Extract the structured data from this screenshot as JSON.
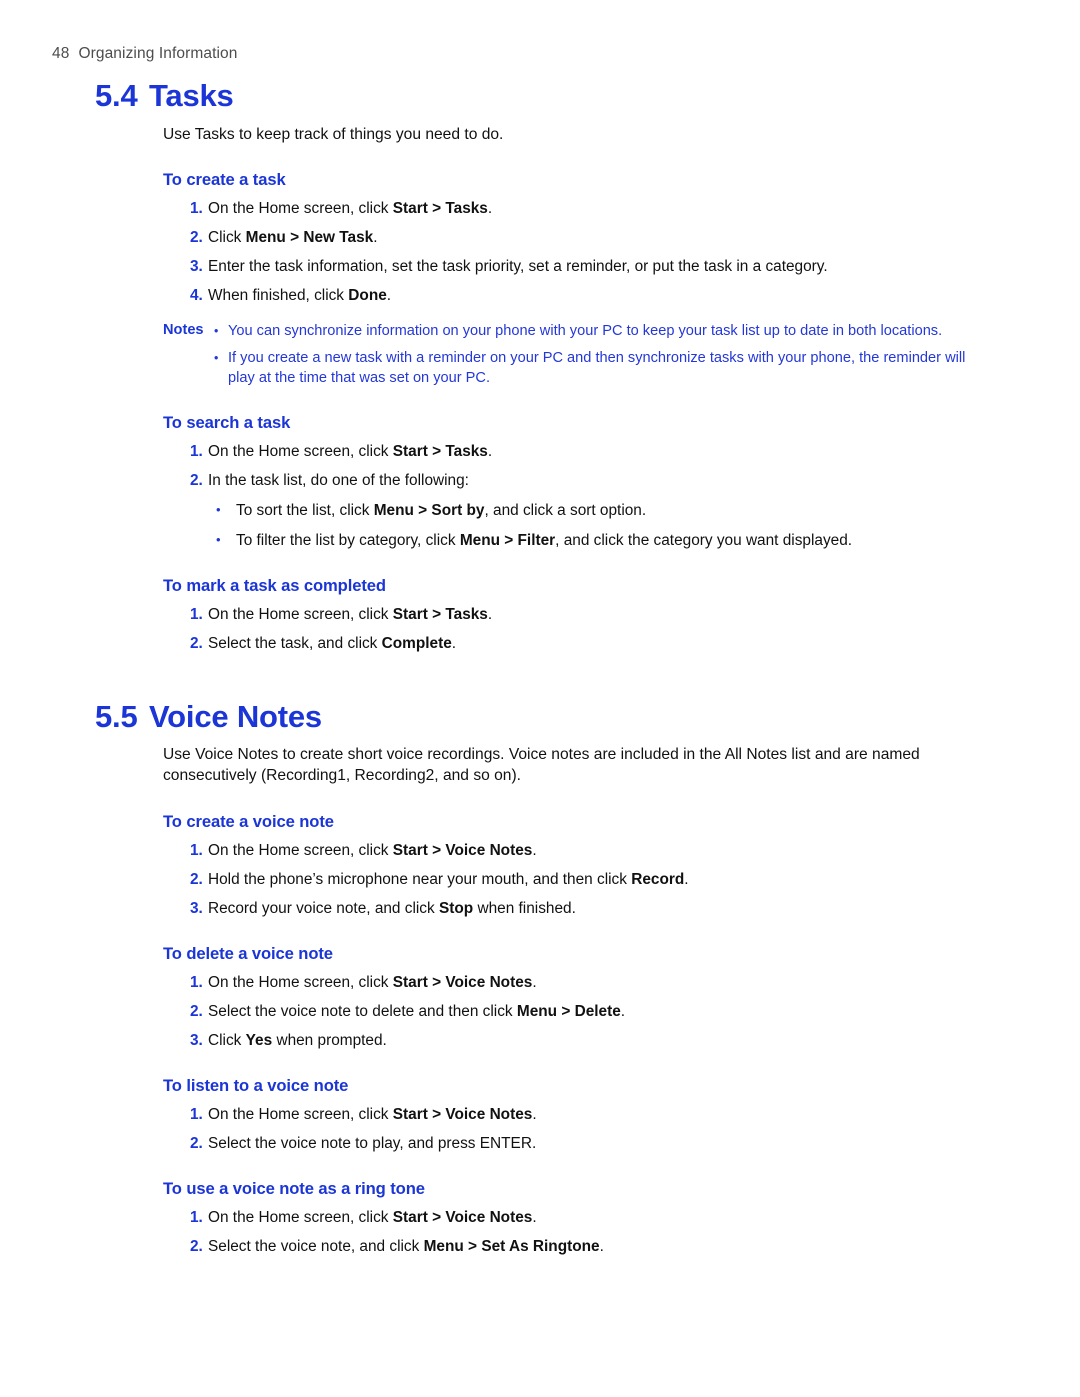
{
  "header": {
    "page_number": "48",
    "chapter_title": "Organizing Information"
  },
  "colors": {
    "heading_blue": "#1b35d6",
    "note_blue": "#2437d8",
    "header_gray": "#4d4d4d",
    "body_black": "#111111"
  },
  "sections": [
    {
      "number": "5.4",
      "title": "Tasks",
      "intro": "Use Tasks to keep track of things you need to do."
    },
    {
      "number": "5.5",
      "title": "Voice Notes",
      "intro": "Use Voice Notes to create short voice recordings. Voice notes are included in the All Notes list and are named consecutively (Recording1, Recording2, and so on)."
    }
  ],
  "tasks": {
    "create": {
      "heading": "To create a task",
      "steps": [
        {
          "n": "1.",
          "parts": [
            {
              "t": "On the Home screen, click ",
              "b": false
            },
            {
              "t": "Start > Tasks",
              "b": true
            },
            {
              "t": ".",
              "b": false
            }
          ]
        },
        {
          "n": "2.",
          "parts": [
            {
              "t": "Click ",
              "b": false
            },
            {
              "t": "Menu > New Task",
              "b": true
            },
            {
              "t": ".",
              "b": false
            }
          ]
        },
        {
          "n": "3.",
          "parts": [
            {
              "t": "Enter the task information, set the task priority, set a reminder, or put the task in a category.",
              "b": false
            }
          ]
        },
        {
          "n": "4.",
          "parts": [
            {
              "t": "When finished, click ",
              "b": false
            },
            {
              "t": "Done",
              "b": true
            },
            {
              "t": ".",
              "b": false
            }
          ]
        }
      ]
    },
    "notes": {
      "label": "Notes",
      "items": [
        "You can synchronize information on your phone with your PC to keep your task list up to date in both locations.",
        "If you create a new task with a reminder on your PC and then synchronize tasks with your phone, the reminder will play at the time that was set on your PC."
      ]
    },
    "search": {
      "heading": "To search a task",
      "steps": [
        {
          "n": "1.",
          "parts": [
            {
              "t": "On the Home screen, click ",
              "b": false
            },
            {
              "t": "Start > Tasks",
              "b": true
            },
            {
              "t": ".",
              "b": false
            }
          ]
        },
        {
          "n": "2.",
          "parts": [
            {
              "t": "In the task list, do one of the following:",
              "b": false
            }
          ]
        }
      ],
      "bullets": [
        [
          {
            "t": "To sort the list, click ",
            "b": false
          },
          {
            "t": "Menu > Sort by",
            "b": true
          },
          {
            "t": ", and click a sort option.",
            "b": false
          }
        ],
        [
          {
            "t": "To filter the list by category, click ",
            "b": false
          },
          {
            "t": "Menu > Filter",
            "b": true
          },
          {
            "t": ", and click the category you want displayed.",
            "b": false
          }
        ]
      ]
    },
    "complete": {
      "heading": "To mark a task as completed",
      "steps": [
        {
          "n": "1.",
          "parts": [
            {
              "t": "On the Home screen, click ",
              "b": false
            },
            {
              "t": "Start > Tasks",
              "b": true
            },
            {
              "t": ".",
              "b": false
            }
          ]
        },
        {
          "n": "2.",
          "parts": [
            {
              "t": "Select the task, and click ",
              "b": false
            },
            {
              "t": "Complete",
              "b": true
            },
            {
              "t": ".",
              "b": false
            }
          ]
        }
      ]
    }
  },
  "voice_notes": {
    "create": {
      "heading": "To create a voice note",
      "steps": [
        {
          "n": "1.",
          "parts": [
            {
              "t": "On the Home screen, click ",
              "b": false
            },
            {
              "t": "Start > Voice Notes",
              "b": true
            },
            {
              "t": ".",
              "b": false
            }
          ]
        },
        {
          "n": "2.",
          "parts": [
            {
              "t": "Hold the phone’s microphone near your mouth, and then click ",
              "b": false
            },
            {
              "t": "Record",
              "b": true
            },
            {
              "t": ".",
              "b": false
            }
          ]
        },
        {
          "n": "3.",
          "parts": [
            {
              "t": "Record your voice note, and click ",
              "b": false
            },
            {
              "t": "Stop",
              "b": true
            },
            {
              "t": " when finished.",
              "b": false
            }
          ]
        }
      ]
    },
    "delete": {
      "heading": "To delete a voice note",
      "steps": [
        {
          "n": "1.",
          "parts": [
            {
              "t": "On the Home screen, click ",
              "b": false
            },
            {
              "t": "Start > Voice Notes",
              "b": true
            },
            {
              "t": ".",
              "b": false
            }
          ]
        },
        {
          "n": "2.",
          "parts": [
            {
              "t": "Select the voice note to delete and then click ",
              "b": false
            },
            {
              "t": "Menu > Delete",
              "b": true
            },
            {
              "t": ".",
              "b": false
            }
          ]
        },
        {
          "n": "3.",
          "parts": [
            {
              "t": "Click ",
              "b": false
            },
            {
              "t": "Yes",
              "b": true
            },
            {
              "t": " when prompted.",
              "b": false
            }
          ]
        }
      ]
    },
    "listen": {
      "heading": "To listen to a voice note",
      "steps": [
        {
          "n": "1.",
          "parts": [
            {
              "t": "On the Home screen, click ",
              "b": false
            },
            {
              "t": "Start > Voice Notes",
              "b": true
            },
            {
              "t": ".",
              "b": false
            }
          ]
        },
        {
          "n": "2.",
          "parts": [
            {
              "t": "Select the voice note to play, and press ENTER.",
              "b": false
            }
          ]
        }
      ]
    },
    "ringtone": {
      "heading": "To use a voice note as a ring tone",
      "steps": [
        {
          "n": "1.",
          "parts": [
            {
              "t": "On the Home screen, click ",
              "b": false
            },
            {
              "t": "Start > Voice Notes",
              "b": true
            },
            {
              "t": ".",
              "b": false
            }
          ]
        },
        {
          "n": "2.",
          "parts": [
            {
              "t": "Select the voice note, and click ",
              "b": false
            },
            {
              "t": "Menu > Set As Ringtone",
              "b": true
            },
            {
              "t": ".",
              "b": false
            }
          ]
        }
      ]
    }
  }
}
